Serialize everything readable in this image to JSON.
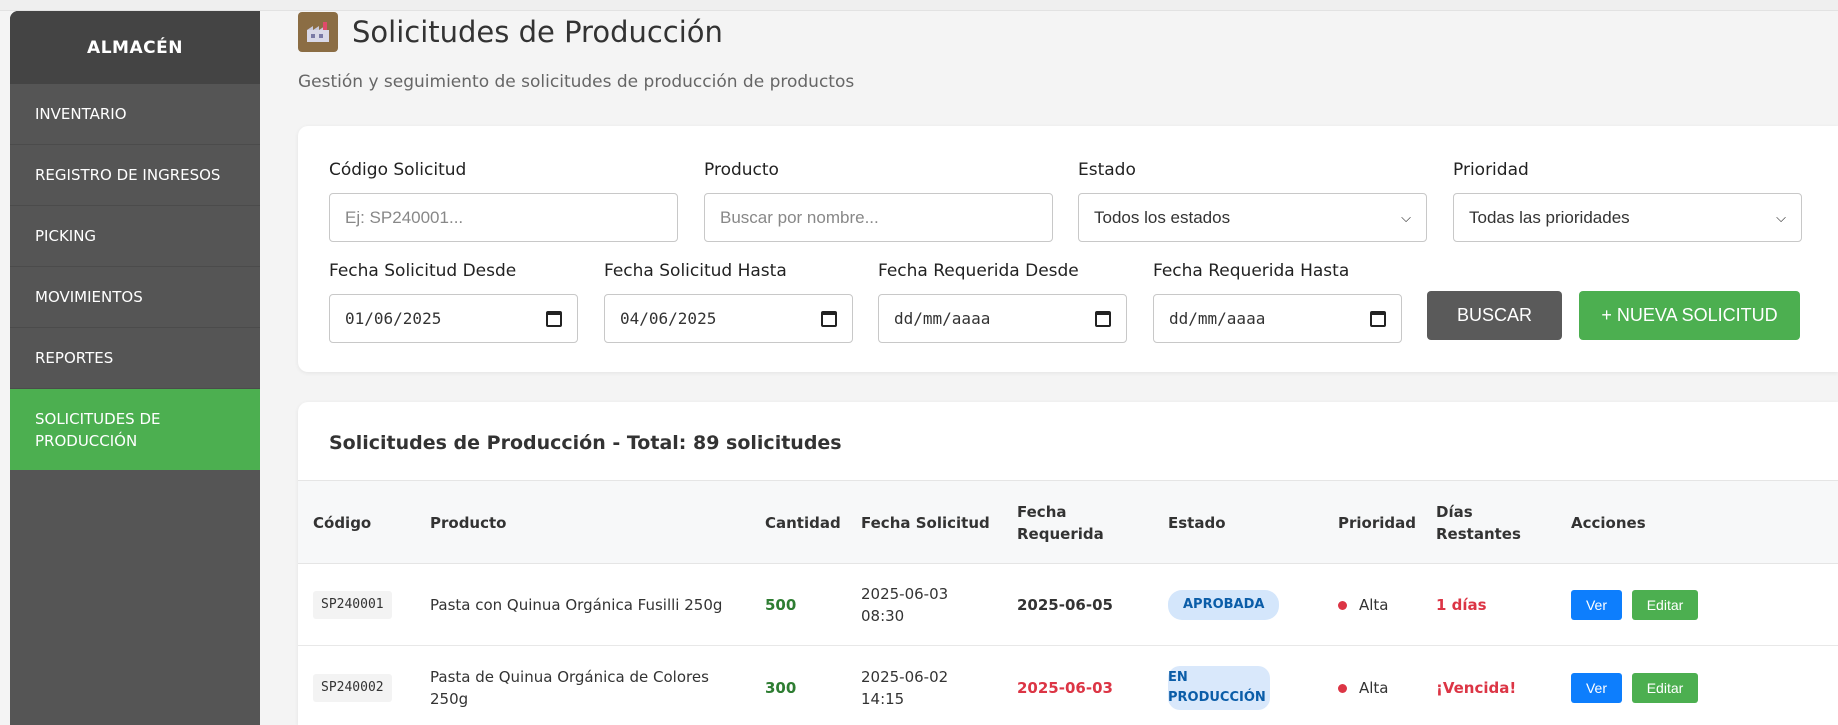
{
  "sidebar": {
    "brand": "ALMACÉN",
    "items": [
      {
        "label": "INVENTARIO"
      },
      {
        "label": "REGISTRO DE INGRESOS"
      },
      {
        "label": "PICKING"
      },
      {
        "label": "MOVIMIENTOS"
      },
      {
        "label": "REPORTES"
      },
      {
        "label": "SOLICITUDES DE PRODUCCIÓN",
        "active": true
      }
    ],
    "active_color": "#4caf50"
  },
  "header": {
    "icon": "factory-icon",
    "title": "Solicitudes de Producción",
    "subtitle": "Gestión y seguimiento de solicitudes de producción de productos"
  },
  "filters": {
    "code": {
      "label": "Código Solicitud",
      "placeholder": "Ej: SP240001..."
    },
    "product": {
      "label": "Producto",
      "placeholder": "Buscar por nombre..."
    },
    "status": {
      "label": "Estado",
      "value": "Todos los estados"
    },
    "priority": {
      "label": "Prioridad",
      "value": "Todas las prioridades"
    },
    "req_from": {
      "label": "Fecha Solicitud Desde",
      "value": "01/06/2025"
    },
    "req_to": {
      "label": "Fecha Solicitud Hasta",
      "value": "04/06/2025"
    },
    "due_from": {
      "label": "Fecha Requerida Desde",
      "value": "dd/mm/aaaa"
    },
    "due_to": {
      "label": "Fecha Requerida Hasta",
      "value": "dd/mm/aaaa"
    },
    "search_button": "BUSCAR",
    "new_button": "+ NUEVA SOLICITUD"
  },
  "table": {
    "title": "Solicitudes de Producción - Total: 89 solicitudes",
    "columns": [
      "Código",
      "Producto",
      "Cantidad",
      "Fecha Solicitud",
      "Fecha Requerida",
      "Estado",
      "Prioridad",
      "Días Restantes",
      "Acciones"
    ],
    "rows": [
      {
        "code": "SP240001",
        "product": "Pasta con Quinua Orgánica Fusilli 250g",
        "quantity": "500",
        "request_date": "2025-06-03 08:30",
        "due_date": "2025-06-05",
        "status": "APROBADA",
        "priority": "Alta",
        "days_left": "1 días",
        "view": "Ver",
        "edit": "Editar"
      },
      {
        "code": "SP240002",
        "product": "Pasta de Quinua Orgánica de Colores 250g",
        "quantity": "300",
        "request_date": "2025-06-02 14:15",
        "due_date": "2025-06-03",
        "status": "EN PRODUCCIÓN",
        "priority": "Alta",
        "days_left": "¡Vencida!",
        "view": "Ver",
        "edit": "Editar"
      }
    ]
  }
}
